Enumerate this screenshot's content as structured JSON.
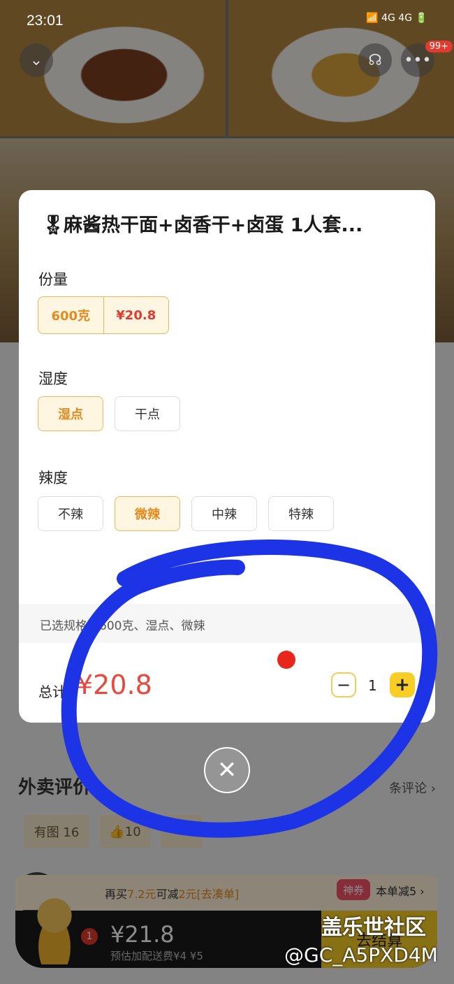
{
  "status_bar": {
    "time": "23:01",
    "icons": "4G 4G"
  },
  "header": {
    "more_badge": "99+"
  },
  "modal": {
    "title": "麻酱热干面+卤香干+卤蛋 1人套...",
    "portion": {
      "label": "份量",
      "size": "600克",
      "price": "¥20.8"
    },
    "groups": [
      {
        "label": "湿度",
        "options": [
          "湿点",
          "干点"
        ],
        "selected": 0
      },
      {
        "label": "辣度",
        "options": [
          "不辣",
          "微辣",
          "中辣",
          "特辣"
        ],
        "selected": 1
      }
    ],
    "selected_spec": "已选规格：600克、湿点、微辣",
    "total_label": "总计",
    "total_price": "¥20.8",
    "quantity": "1",
    "minus": "−",
    "plus": "+"
  },
  "reviews": {
    "title": "外卖评价",
    "count_link": "条评论",
    "tags": [
      "有图 16",
      "10",
      ""
    ]
  },
  "promo": {
    "prefix": "再买",
    "amount": "7.2元",
    "middle": "可减",
    "discount": "2元",
    "link": "[去凑单]",
    "coupon_tag": "神券",
    "coupon_text": "本单减5"
  },
  "cart": {
    "badge": "1",
    "price": "¥21.8",
    "fee": "预估加配送费¥4 ¥5",
    "checkout": "去结算"
  },
  "watermark": {
    "line1": "盖乐世社区",
    "line2": "@GC_A5PXD4M"
  },
  "colors": {
    "accent": "#f7cd26",
    "price": "#e8483e",
    "selected": "#e58a1f",
    "annotation": "#1d33e6"
  }
}
